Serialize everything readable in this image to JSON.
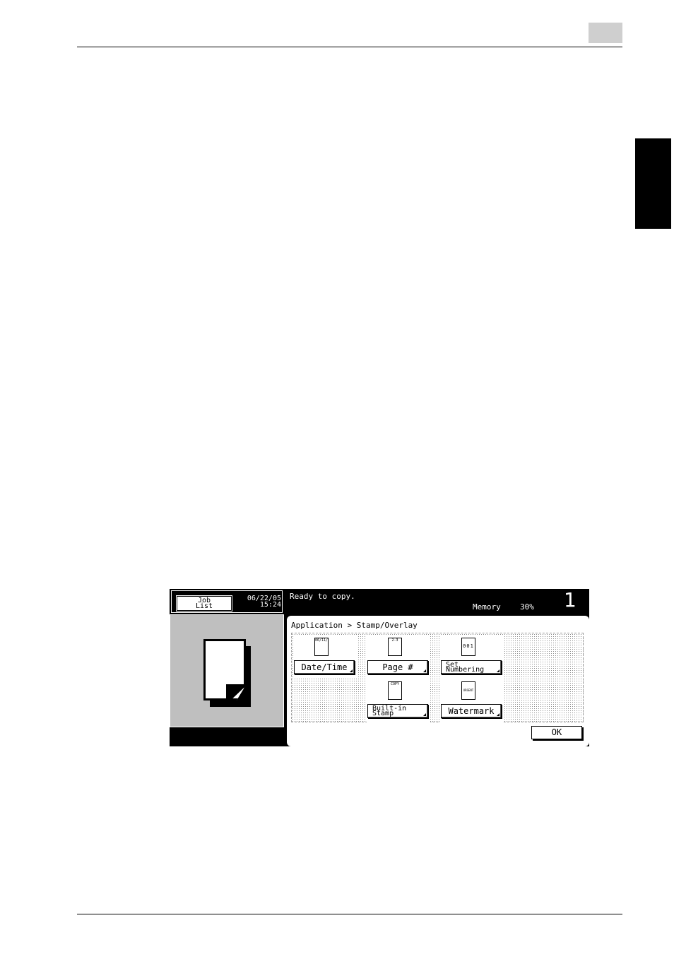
{
  "panel": {
    "job_list_label_line1": "Job",
    "job_list_label_line2": "List",
    "date": "06/22/05",
    "time": "15:24",
    "status": "Ready to copy.",
    "memory_label": "Memory",
    "memory_value": "30%",
    "copy_count": "1",
    "breadcrumb": "Application > Stamp/Overlay",
    "buttons": {
      "date_time": {
        "label": "Date/Time",
        "icon_text": "06/11/22",
        "icon": "date-document-icon"
      },
      "page_number": {
        "label": "Page #",
        "icon_text": "2-3",
        "icon": "page-number-document-icon"
      },
      "set_numbering": {
        "label_line1": "Set",
        "label_line2": "Numbering",
        "icon_text": "001",
        "icon": "set-numbering-document-icon"
      },
      "built_in_stamp": {
        "label_line1": "Built-in",
        "label_line2": "Stamp",
        "icon_text": "COPY",
        "icon": "stamp-document-icon"
      },
      "watermark": {
        "label": "Watermark",
        "icon_text": "URGENT",
        "icon": "watermark-document-icon"
      }
    },
    "ok_label": "OK"
  }
}
